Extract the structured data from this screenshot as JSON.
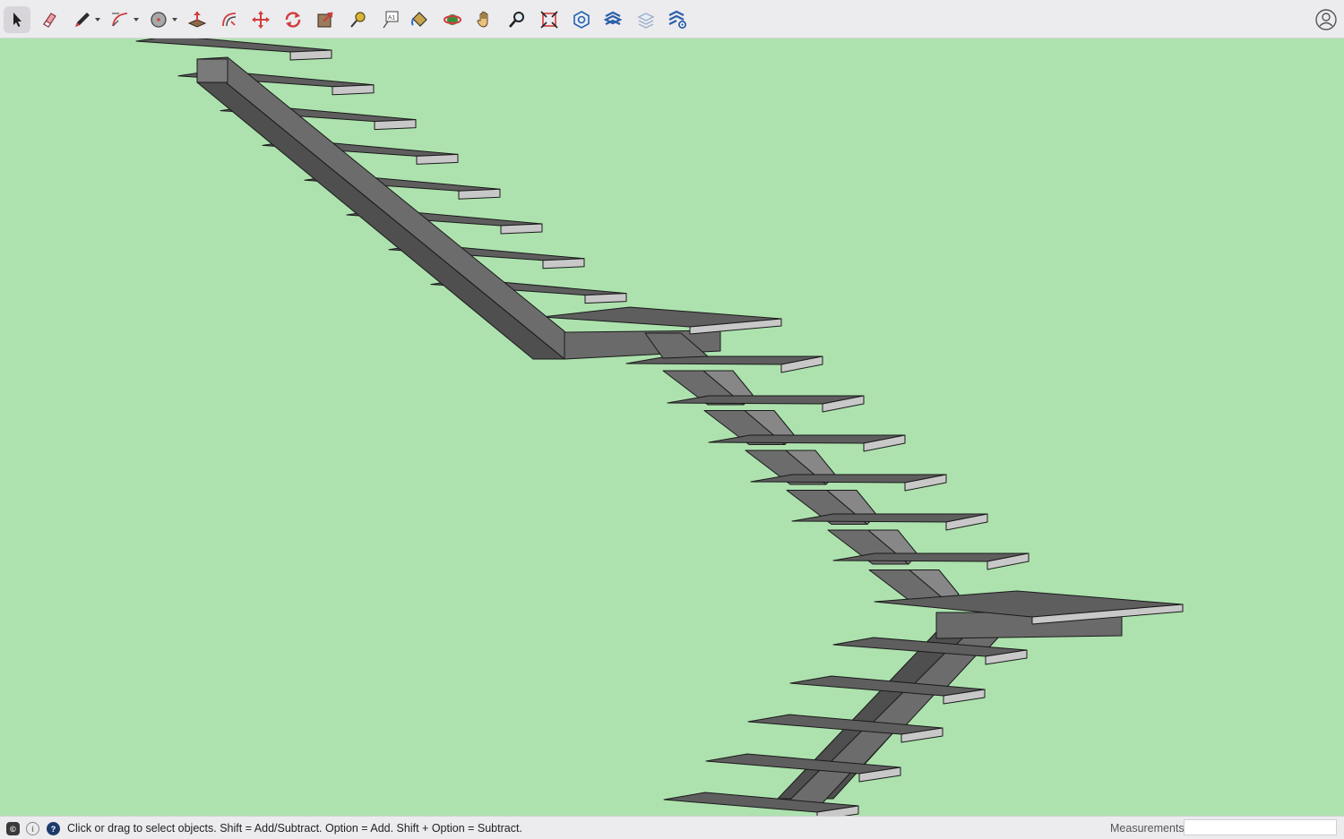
{
  "toolbar": {
    "tools": [
      {
        "name": "select",
        "tooltip": "Select",
        "active": true
      },
      {
        "name": "eraser",
        "tooltip": "Eraser"
      },
      {
        "name": "line",
        "tooltip": "Line",
        "has_menu": true
      },
      {
        "name": "arc",
        "tooltip": "Arc",
        "has_menu": true
      },
      {
        "name": "shape",
        "tooltip": "Shapes",
        "has_menu": true
      },
      {
        "name": "push-pull",
        "tooltip": "Push/Pull"
      },
      {
        "name": "offset",
        "tooltip": "Offset"
      },
      {
        "name": "move",
        "tooltip": "Move"
      },
      {
        "name": "rotate",
        "tooltip": "Rotate"
      },
      {
        "name": "scale",
        "tooltip": "Scale"
      },
      {
        "name": "tape-measure",
        "tooltip": "Tape Measure"
      },
      {
        "name": "text",
        "tooltip": "Text"
      },
      {
        "name": "paint-bucket",
        "tooltip": "Paint Bucket"
      },
      {
        "name": "orbit",
        "tooltip": "Orbit"
      },
      {
        "name": "pan",
        "tooltip": "Pan"
      },
      {
        "name": "zoom",
        "tooltip": "Zoom"
      },
      {
        "name": "zoom-extents",
        "tooltip": "Zoom Extents"
      },
      {
        "name": "warehouse",
        "tooltip": "3D Warehouse"
      },
      {
        "name": "extension-1",
        "tooltip": "Extension"
      },
      {
        "name": "layers",
        "tooltip": "Layers"
      },
      {
        "name": "extension-settings",
        "tooltip": "Extension Settings"
      }
    ],
    "account_icon": "user-circle-icon"
  },
  "viewport": {
    "background": "#ade2ae",
    "model_description": "Steel staircase with open treads and landings"
  },
  "statusbar": {
    "message": "Click or drag to select objects. Shift = Add/Subtract. Option = Add. Shift + Option = Subtract.",
    "measurements_label": "Measurements",
    "measurements_value": ""
  },
  "colors": {
    "tread_top": "#5e5e5e",
    "tread_front": "#c8c8c8",
    "stringer_dark": "#4f4f4f",
    "stringer_mid": "#6c6c6c",
    "stringer_light": "#878787",
    "edge": "#1a1a1a"
  }
}
